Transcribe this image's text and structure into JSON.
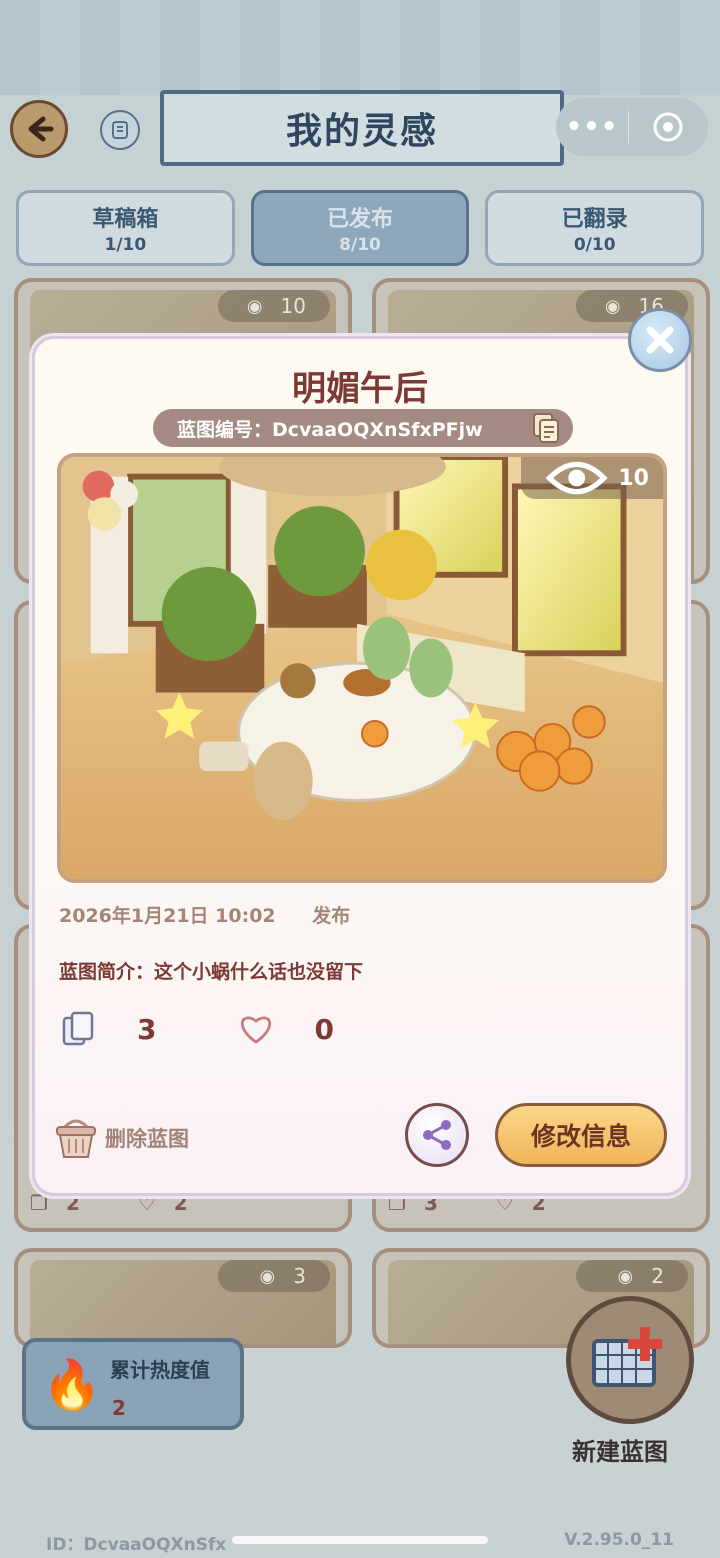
{
  "header": {
    "title": "我的灵感",
    "capsule_dots": "•••"
  },
  "tabs": [
    {
      "label": "草稿箱",
      "count": "1/10"
    },
    {
      "label": "已发布",
      "count": "8/10"
    },
    {
      "label": "已翻录",
      "count": "0/10"
    }
  ],
  "cards": [
    {
      "views": "10",
      "copies": "2",
      "likes": "2"
    },
    {
      "views": "16",
      "copies": "3",
      "likes": "2"
    },
    {
      "views": "3"
    },
    {
      "views": "2"
    }
  ],
  "heat": {
    "label": "累计热度值",
    "value": "2"
  },
  "new_blueprint": {
    "label": "新建蓝图"
  },
  "footer": {
    "id": "ID：DcvaaOQXnSfx",
    "version": "V.2.95.0_11"
  },
  "modal": {
    "title": "明媚午后",
    "blueprint_id": "蓝图编号：DcvaaOQXnSfxPFjw",
    "views": "10",
    "date": "2026年1月21日 10:02",
    "status": "发布",
    "description": "蓝图简介：这个小蜗什么话也没留下",
    "copies": "3",
    "likes": "0",
    "delete_label": "删除蓝图",
    "edit_label": "修改信息"
  },
  "colors": {
    "accent": "#f0b45a",
    "title_text": "#7b3a34",
    "nav_blue": "#4e6a86"
  }
}
